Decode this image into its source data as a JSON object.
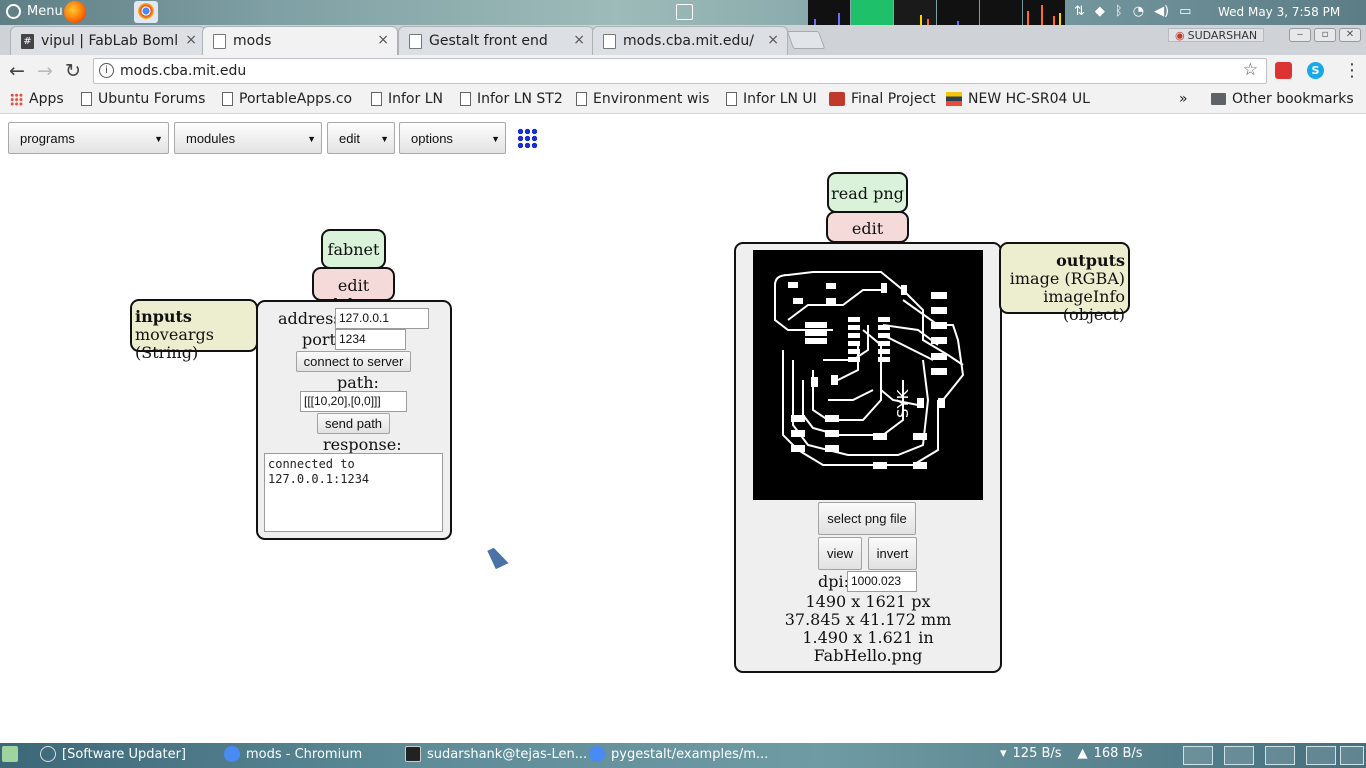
{
  "system_panel": {
    "menu_label": "Menu",
    "clock": "Wed May  3,  7:58 PM"
  },
  "browser": {
    "tabs": [
      {
        "label": "vipul | FabLab Boml",
        "close": "×"
      },
      {
        "label": "mods",
        "close": "×"
      },
      {
        "label": "Gestalt front end",
        "close": "×"
      },
      {
        "label": "mods.cba.mit.edu/",
        "close": "×"
      }
    ],
    "profile_name": "SUDARSHAN",
    "url": "mods.cba.mit.edu",
    "bookmarks": [
      {
        "label": "Apps"
      },
      {
        "label": "Ubuntu Forums"
      },
      {
        "label": "PortableApps.co"
      },
      {
        "label": "Infor LN"
      },
      {
        "label": "Infor LN ST2"
      },
      {
        "label": "Environment wis"
      },
      {
        "label": "Infor LN UI"
      },
      {
        "label": "Final Project"
      },
      {
        "label": "NEW HC-SR04 UL"
      },
      {
        "label": "»"
      },
      {
        "label": "Other bookmarks"
      }
    ]
  },
  "menu": {
    "programs": "programs",
    "modules": "modules",
    "edit": "edit",
    "options": "options",
    "caret": "▼"
  },
  "fabnet_module": {
    "title": "fabnet",
    "edit_delete": "edit delete",
    "inputs_heading": "inputs",
    "inputs_item": "moveargs (String)",
    "address_label": "address:",
    "address_value": "127.0.0.1",
    "port_label": "port:",
    "port_value": "1234",
    "connect_button": "connect to server",
    "path_label": "path:",
    "path_value": "[[[10,20],[0,0]]]",
    "send_button": "send path",
    "response_label": "response:",
    "response_value": "connected to\n127.0.0.1:1234"
  },
  "readpng_module": {
    "title": "read png",
    "edit_delete": "edit delete",
    "outputs_heading": "outputs",
    "outputs_items": [
      "image (RGBA)",
      "imageInfo (object)"
    ],
    "select_button": "select png file",
    "view_button": "view",
    "invert_button": "invert",
    "dpi_label": "dpi:",
    "dpi_value": "1000.023",
    "size_px": "1490 x 1621 px",
    "size_mm": "37.845 x 41.172 mm",
    "size_in": "1.490 x 1.621 in",
    "filename": "FabHello.png",
    "board_text": "SYK"
  },
  "taskbar": {
    "items": [
      {
        "label": "[Software Updater]"
      },
      {
        "label": "mods - Chromium"
      },
      {
        "label": "sudarshank@tejas-Len..."
      },
      {
        "label": "pygestalt/examples/m..."
      }
    ],
    "net_down": "125 B/s",
    "net_up": "168 B/s"
  }
}
